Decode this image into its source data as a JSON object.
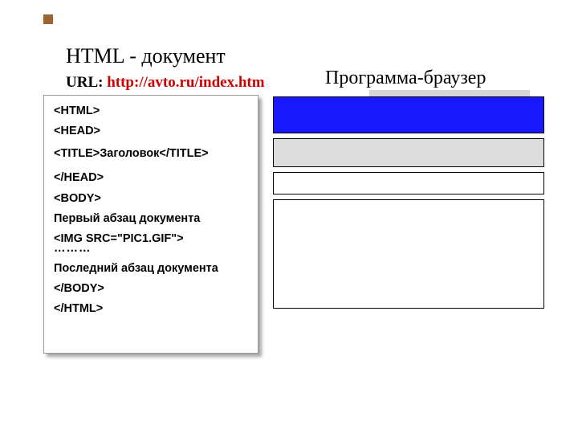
{
  "accent": "#996633",
  "headings": {
    "left": "HTML - документ",
    "right": "Программа-браузер"
  },
  "url": {
    "label": "URL: ",
    "value": "http://avto.ru/index.htm"
  },
  "code_lines": {
    "l1": "<HTML>",
    "l2": "<HEAD>",
    "l3": "<TITLE>Заголовок</TITLE>",
    "l4": "</HEAD>",
    "l5": "<BODY>",
    "l6": "Первый абзац документа",
    "l7": "<IMG SRC=\"PIC1.GIF\">",
    "dots": "………",
    "l8": "Последний абзац документа",
    "l9": "</BODY>",
    "l10": "</HTML>"
  },
  "browser": {
    "titlebar_color": "#1919ff",
    "toolbar_color": "#dcdcdc",
    "content_color": "#ffffff"
  }
}
